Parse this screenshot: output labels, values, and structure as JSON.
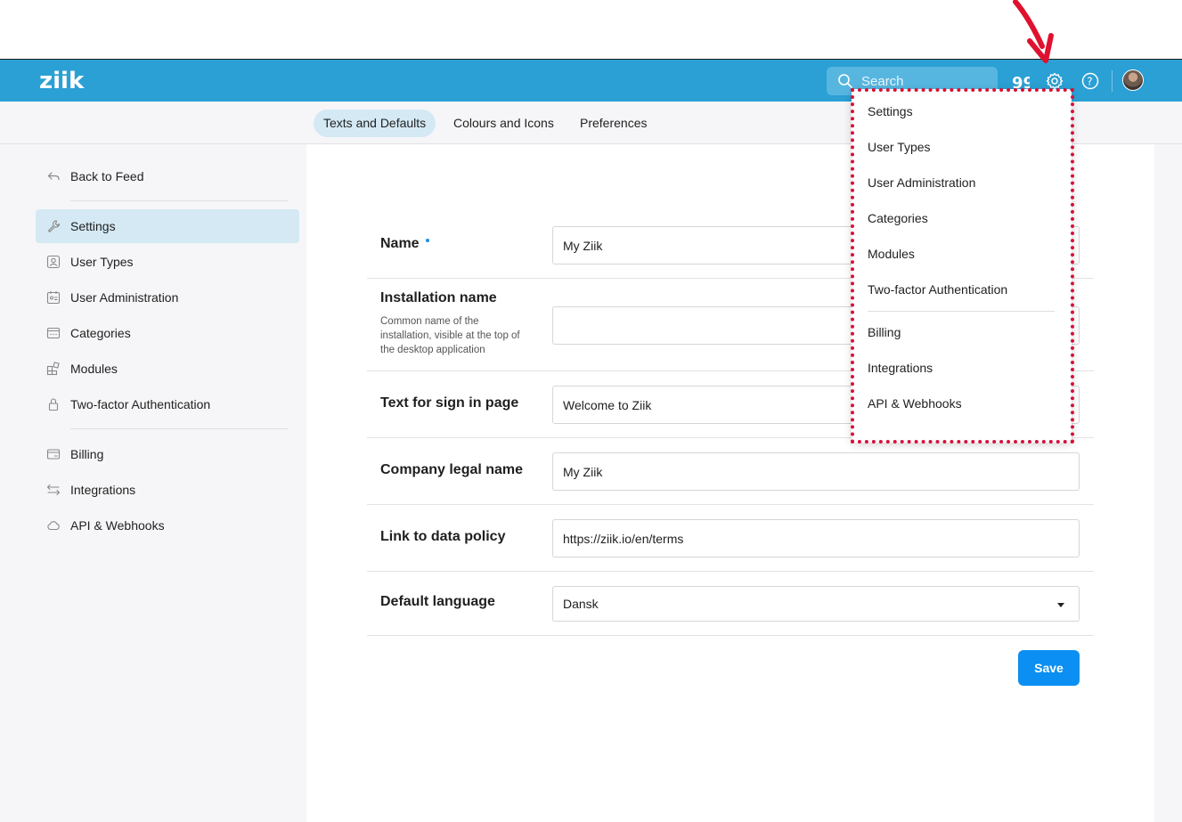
{
  "header": {
    "logo": "ziik",
    "search_placeholder": "Search",
    "icons": [
      "search-icon",
      "quote-icon",
      "gear-icon",
      "help-icon",
      "user-avatar"
    ]
  },
  "tabs": [
    {
      "label": "Texts and Defaults",
      "active": true
    },
    {
      "label": "Colours and Icons",
      "active": false
    },
    {
      "label": "Preferences",
      "active": false
    }
  ],
  "sidebar": {
    "back": "Back to Feed",
    "items": [
      {
        "label": "Settings",
        "icon": "wrench-icon",
        "active": true
      },
      {
        "label": "User Types",
        "icon": "user-type-icon"
      },
      {
        "label": "User Administration",
        "icon": "id-card-icon"
      },
      {
        "label": "Categories",
        "icon": "categories-icon"
      },
      {
        "label": "Modules",
        "icon": "modules-icon"
      },
      {
        "label": "Two-factor Authentication",
        "icon": "lock-icon"
      },
      {
        "label": "Billing",
        "icon": "card-icon"
      },
      {
        "label": "Integrations",
        "icon": "arrows-icon"
      },
      {
        "label": "API & Webhooks",
        "icon": "cloud-icon"
      }
    ]
  },
  "form": {
    "name_label": "Name",
    "name_value": "My Ziik",
    "installation_label": "Installation name",
    "installation_desc": "Common name of the installation, visible at the top of the desktop application",
    "installation_value": "",
    "signin_label": "Text for sign in page",
    "signin_value": "Welcome to Ziik",
    "company_label": "Company legal name",
    "company_value": "My Ziik",
    "policy_label": "Link to data policy",
    "policy_value": "https://ziik.io/en/terms",
    "language_label": "Default language",
    "language_value": "Dansk",
    "save_label": "Save"
  },
  "dropdown": {
    "items": [
      "Settings",
      "User Types",
      "User Administration",
      "Categories",
      "Modules",
      "Two-factor Authentication",
      "Billing",
      "Integrations",
      "API & Webhooks"
    ]
  },
  "colors": {
    "header": "#2ba0d4",
    "accent": "#0b8ff2",
    "active_bg": "#d4e9f4",
    "highlight": "#d8103a"
  }
}
